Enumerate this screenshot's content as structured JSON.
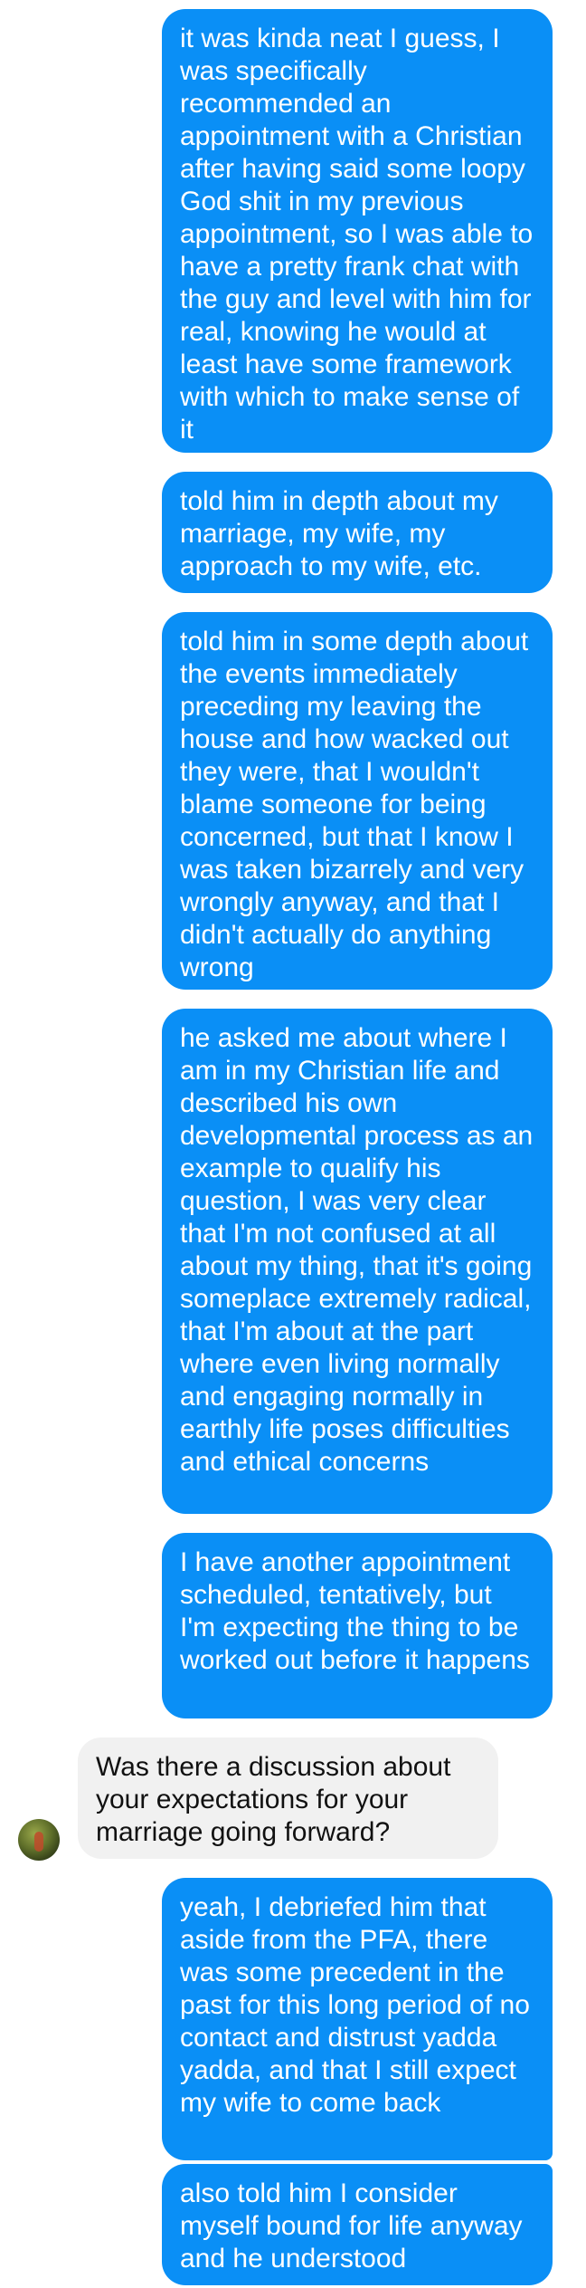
{
  "messages": [
    {
      "direction": "sent",
      "text": "it was kinda neat I guess, I was specifically recommended an appointment with a Christian after having said some loopy God shit in my previous appointment, so I was able to have a pretty frank chat with the guy and level with him for real, knowing he would at least have some framework with which to make sense of it"
    },
    {
      "direction": "sent",
      "text": "told him in depth about my marriage, my wife, my approach to my wife, etc."
    },
    {
      "direction": "sent",
      "text": "told him in some depth about the events immediately preceding my leaving the house and how wacked out they were, that I wouldn't blame someone for being concerned, but that I know I was taken bizarrely and very wrongly anyway, and that I didn't actually do anything wrong"
    },
    {
      "direction": "sent",
      "text": "he asked me about where I am in my Christian life and described his own developmental process as an example to qualify his question, I was very clear that I'm not confused at all about my thing, that it's going someplace extremely radical, that I'm about at the part where even living normally and engaging normally in earthly life poses difficulties and ethical concerns"
    },
    {
      "direction": "sent",
      "text": "I have another appointment scheduled, tentatively, but I'm expecting the thing to be worked out before it happens"
    },
    {
      "direction": "received",
      "text": "Was there a discussion about your expectations for your marriage going forward?"
    },
    {
      "direction": "sent",
      "text": "yeah, I debriefed him that aside from the PFA, there was some precedent in the past for this long period of no contact and distrust yadda yadda, and that I still expect my wife to come back"
    },
    {
      "direction": "sent",
      "text": "also told him I consider myself bound for life anyway and he understood"
    }
  ],
  "colors": {
    "sent_bubble": "#0a8ff6",
    "sent_text": "#ffffff",
    "received_bubble": "#f1f1f1",
    "received_text": "#111111"
  },
  "icons": {
    "avatar": "contact-avatar-photo"
  }
}
